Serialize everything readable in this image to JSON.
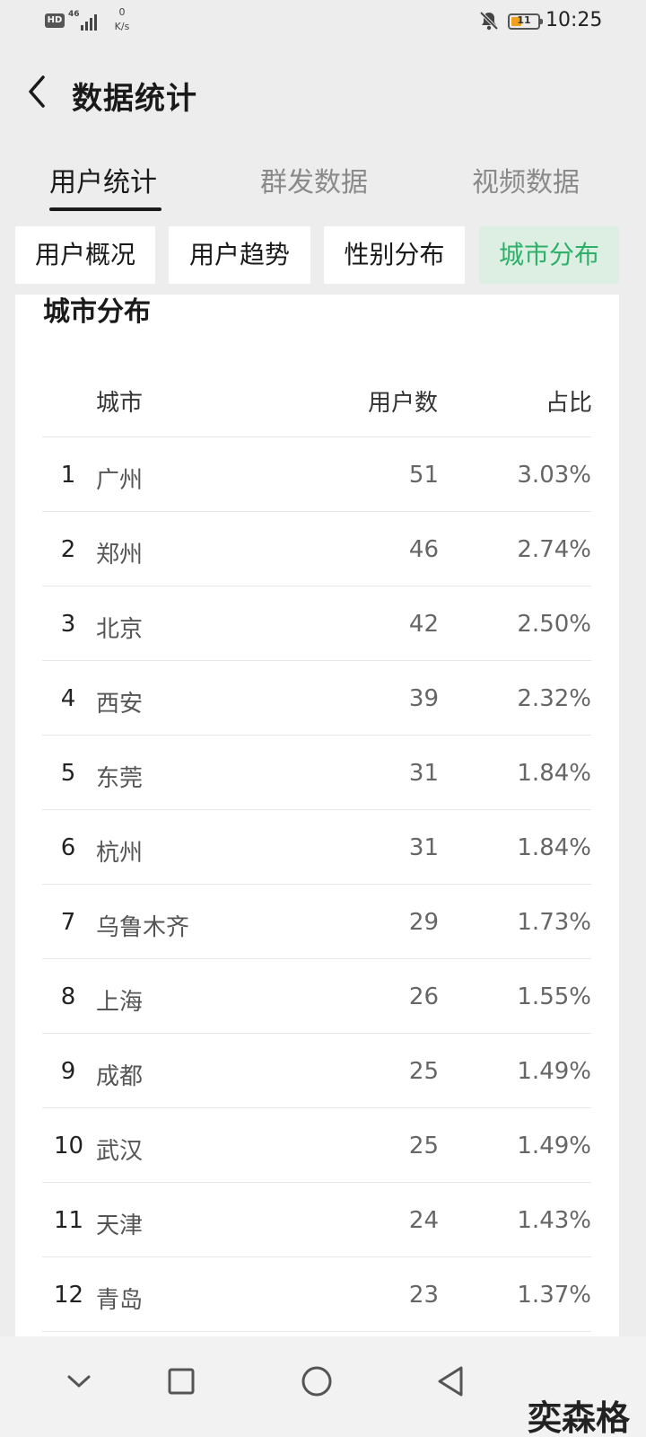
{
  "status_bar": {
    "hd": "HD",
    "network": "46",
    "net_speed_value": "0",
    "net_speed_unit": "K/s",
    "battery_level": "11",
    "time": "10:25"
  },
  "header": {
    "title": "数据统计"
  },
  "tabs": [
    {
      "label": "用户统计",
      "active": true
    },
    {
      "label": "群发数据",
      "active": false
    },
    {
      "label": "视频数据",
      "active": false
    }
  ],
  "subtabs": [
    {
      "label": "用户概况",
      "active": false
    },
    {
      "label": "用户趋势",
      "active": false
    },
    {
      "label": "性别分布",
      "active": false
    },
    {
      "label": "城市分布",
      "active": true
    }
  ],
  "section": {
    "title": "城市分布",
    "columns": {
      "city": "城市",
      "users": "用户数",
      "ratio": "占比"
    }
  },
  "rows": [
    {
      "rank": "1",
      "city": "广州",
      "users": "51",
      "ratio": "3.03%"
    },
    {
      "rank": "2",
      "city": "郑州",
      "users": "46",
      "ratio": "2.74%"
    },
    {
      "rank": "3",
      "city": "北京",
      "users": "42",
      "ratio": "2.50%"
    },
    {
      "rank": "4",
      "city": "西安",
      "users": "39",
      "ratio": "2.32%"
    },
    {
      "rank": "5",
      "city": "东莞",
      "users": "31",
      "ratio": "1.84%"
    },
    {
      "rank": "6",
      "city": "杭州",
      "users": "31",
      "ratio": "1.84%"
    },
    {
      "rank": "7",
      "city": "乌鲁木齐",
      "users": "29",
      "ratio": "1.73%"
    },
    {
      "rank": "8",
      "city": "上海",
      "users": "26",
      "ratio": "1.55%"
    },
    {
      "rank": "9",
      "city": "成都",
      "users": "25",
      "ratio": "1.49%"
    },
    {
      "rank": "10",
      "city": "武汉",
      "users": "25",
      "ratio": "1.49%"
    },
    {
      "rank": "11",
      "city": "天津",
      "users": "24",
      "ratio": "1.43%"
    },
    {
      "rank": "12",
      "city": "青岛",
      "users": "23",
      "ratio": "1.37%"
    }
  ],
  "watermark": "奕森格",
  "colors": {
    "accent": "#2fb06a",
    "accent_bg": "#dcefe2",
    "background": "#ededed"
  },
  "icons": {
    "back": "chevron-left-icon",
    "bell": "bell-off-icon",
    "nav_down": "chevron-down-icon",
    "nav_recent": "square-icon",
    "nav_home": "circle-icon",
    "nav_back": "triangle-left-icon"
  }
}
